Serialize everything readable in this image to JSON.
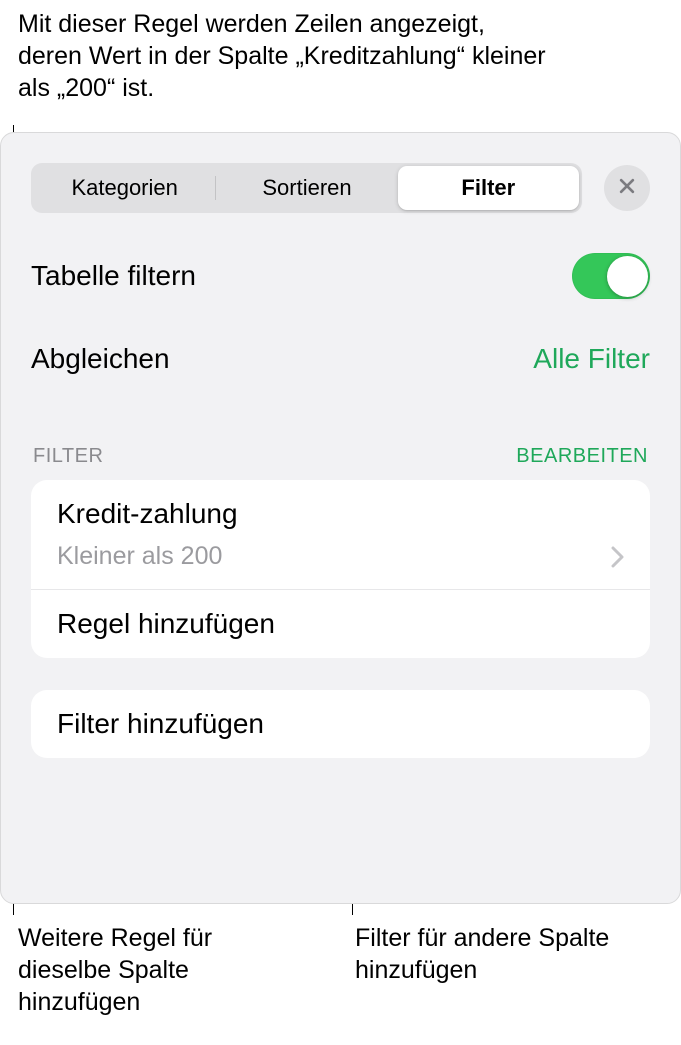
{
  "callouts": {
    "top": "Mit dieser Regel werden Zeilen angezeigt, deren Wert in der Spalte „Kreditzahlung“ kleiner als „200“ ist.",
    "bottom_left": "Weitere Regel für dieselbe Spalte hinzufügen",
    "bottom_right": "Filter für andere Spalte hinzufügen"
  },
  "tabs": {
    "categories": "Kategorien",
    "sort": "Sortieren",
    "filter": "Filter"
  },
  "filter_table": {
    "label": "Tabelle filtern",
    "enabled": true
  },
  "match": {
    "label": "Abgleichen",
    "value": "Alle Filter"
  },
  "section": {
    "title": "FILTER",
    "edit": "BEARBEITEN"
  },
  "filter_rule": {
    "column": "Kredit-zahlung",
    "condition": "Kleiner als 200",
    "add_rule": "Regel hinzufügen"
  },
  "add_filter": "Filter hinzufügen"
}
